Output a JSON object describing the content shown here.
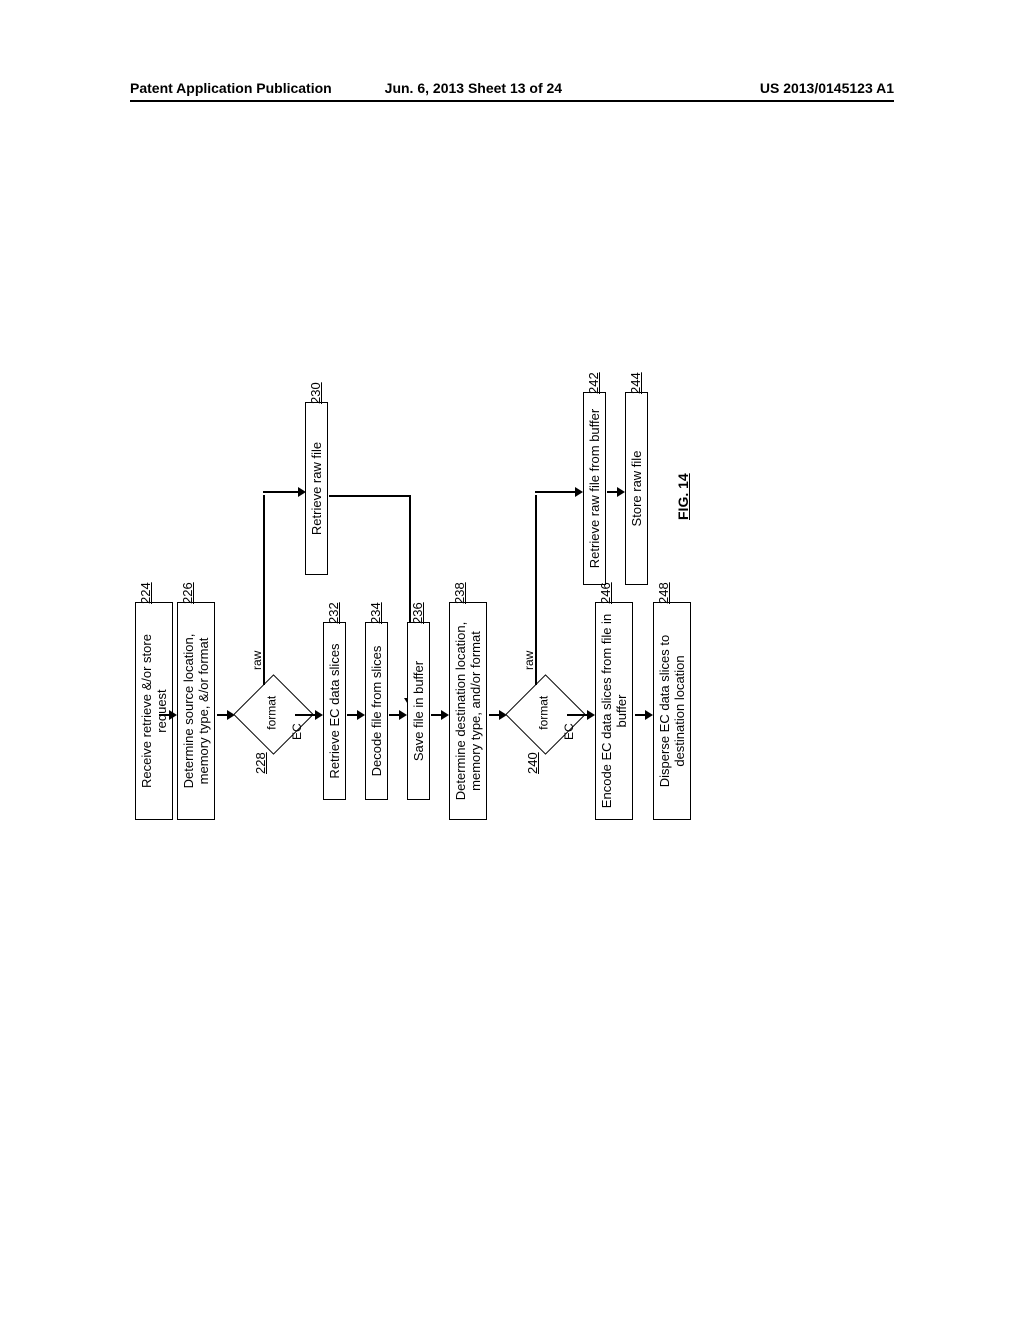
{
  "header": {
    "left": "Patent Application Publication",
    "center": "Jun. 6, 2013  Sheet 13 of 24",
    "right": "US 2013/0145123 A1"
  },
  "figure_label": "FIG. 14",
  "flowchart": {
    "n224": {
      "text": "Receive retrieve &/or store request",
      "ref": "224"
    },
    "n226": {
      "text": "Determine source location, memory type, &/or format",
      "ref": "226"
    },
    "d228": {
      "label": "format",
      "ref": "228",
      "left": "EC",
      "right": "raw"
    },
    "n230": {
      "text": "Retrieve raw file",
      "ref": "230"
    },
    "n232": {
      "text": "Retrieve EC data slices",
      "ref": "232"
    },
    "n234": {
      "text": "Decode file from slices",
      "ref": "234"
    },
    "n236": {
      "text": "Save file in buffer",
      "ref": "236"
    },
    "n238": {
      "text": "Determine destination location, memory type, and/or format",
      "ref": "238"
    },
    "d240": {
      "label": "format",
      "ref": "240",
      "left": "EC",
      "right": "raw"
    },
    "n242": {
      "text": "Retrieve raw file from buffer",
      "ref": "242"
    },
    "n244": {
      "text": "Store raw file",
      "ref": "244"
    },
    "n246": {
      "text": "Encode EC data slices from file in buffer",
      "ref": "246"
    },
    "n248": {
      "text": "Disperse EC data slices to destination location",
      "ref": "248"
    }
  }
}
